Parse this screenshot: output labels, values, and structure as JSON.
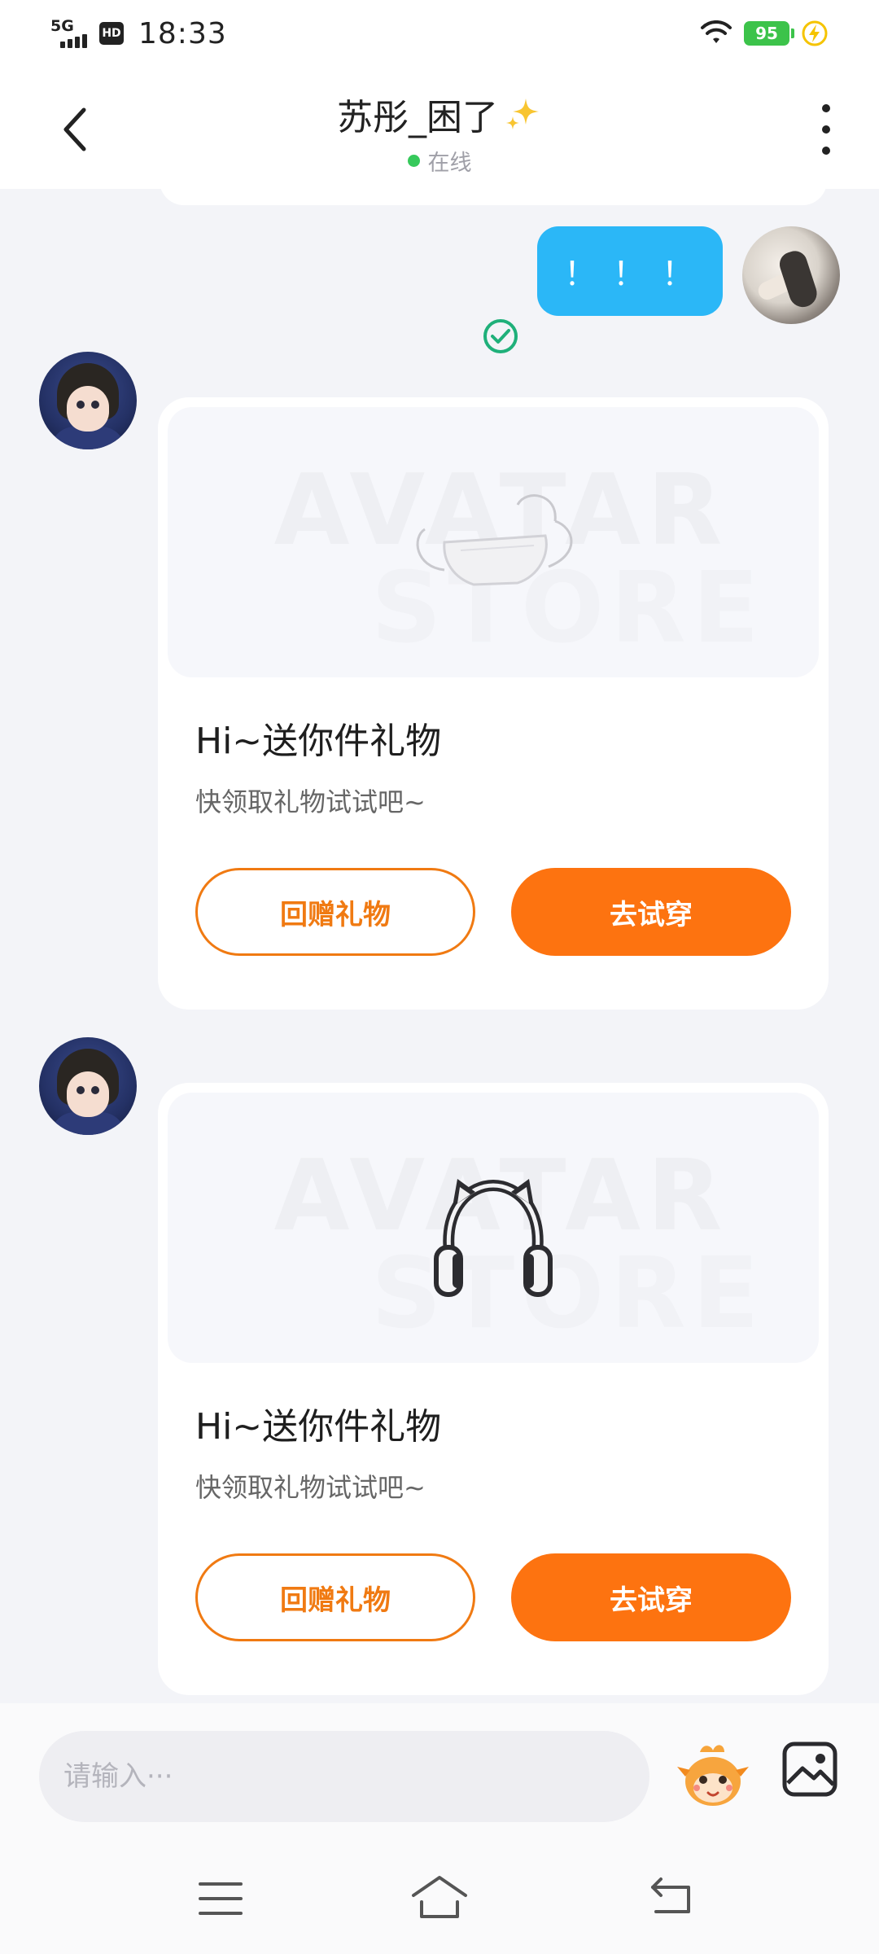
{
  "status_bar": {
    "network": "5G",
    "hd_label": "HD",
    "time": "18:33",
    "battery": "95"
  },
  "header": {
    "title": "苏彤_困了",
    "status": "在线"
  },
  "messages": {
    "outgoing_text": "！！！",
    "gift_cards": [
      {
        "title": "Hi~送你件礼物",
        "subtitle": "快领取礼物试试吧~",
        "return_label": "回赠礼物",
        "try_label": "去试穿",
        "item_icon": "face-mask"
      },
      {
        "title": "Hi~送你件礼物",
        "subtitle": "快领取礼物试试吧~",
        "return_label": "回赠礼物",
        "try_label": "去试穿",
        "item_icon": "cat-ear-headphones"
      }
    ]
  },
  "input": {
    "placeholder": "请输入···",
    "value": ""
  },
  "colors": {
    "accent_orange": "#fd7310",
    "bubble_blue": "#2bb7f7",
    "online_green": "#36c95b"
  }
}
